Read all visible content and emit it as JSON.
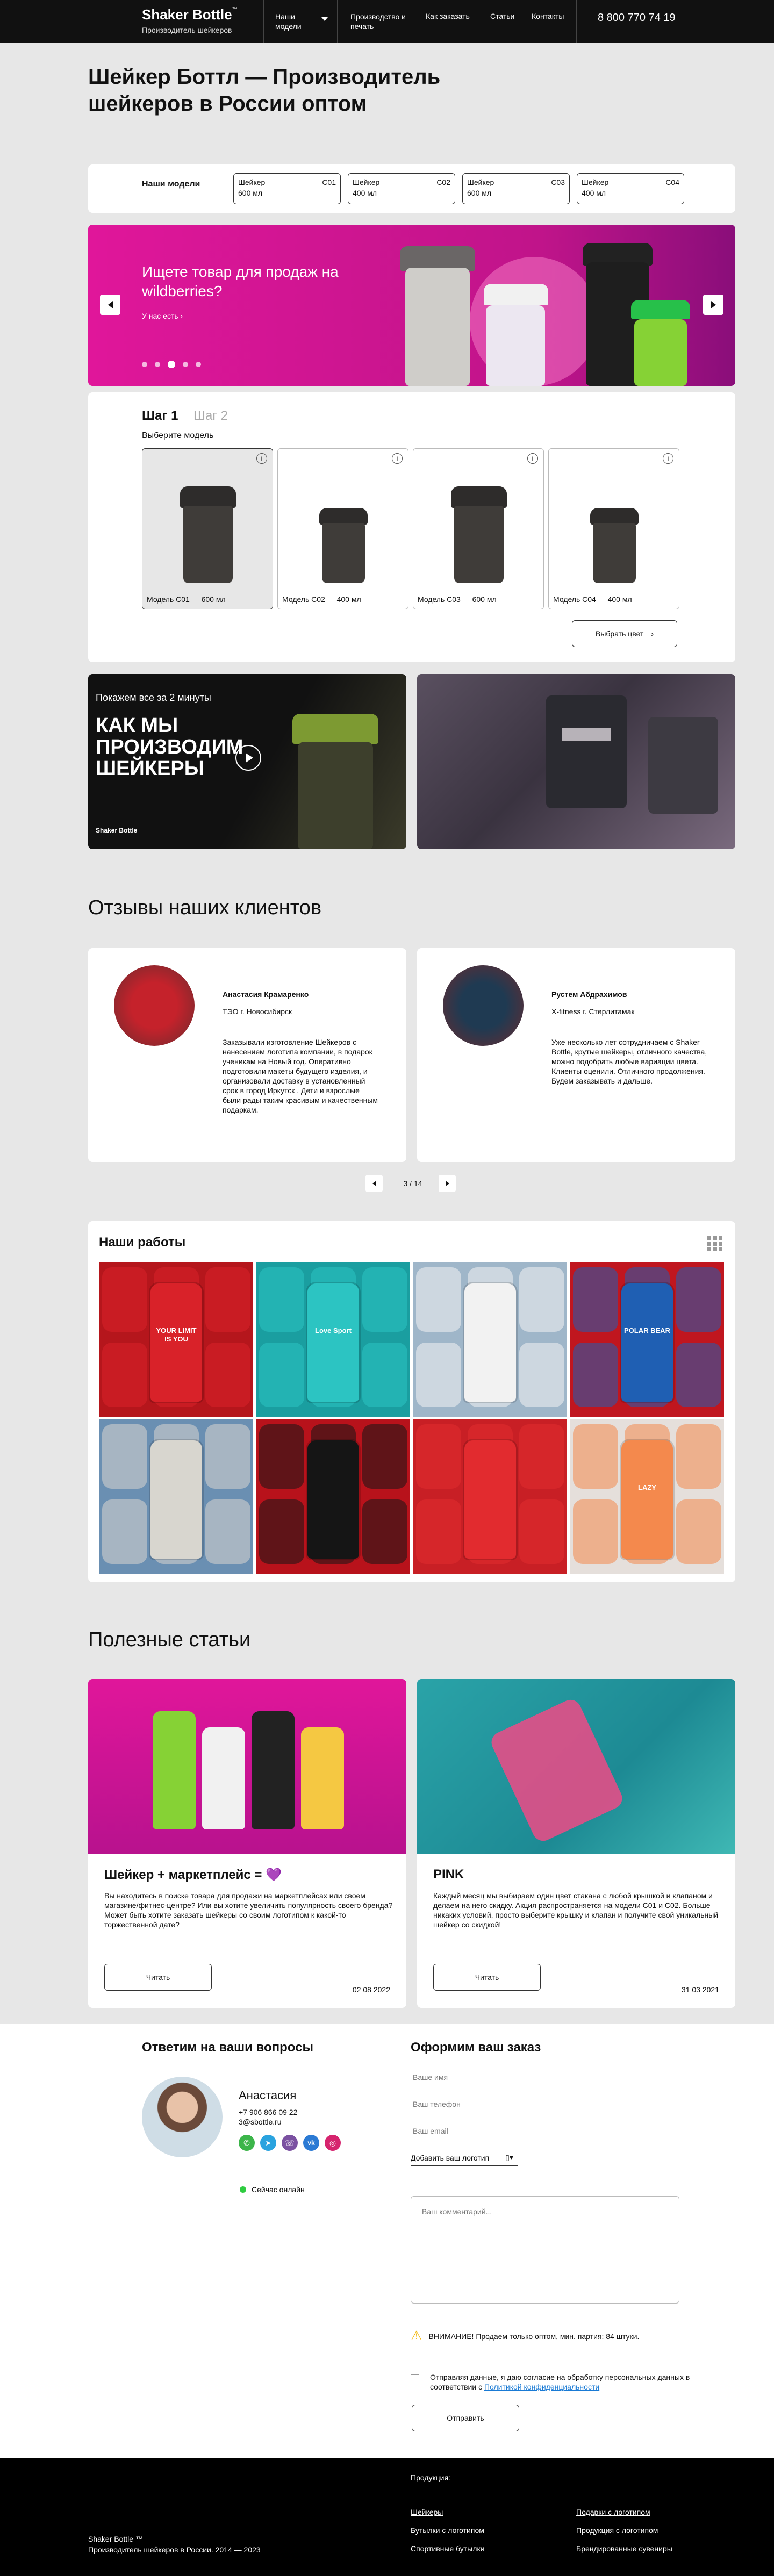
{
  "header": {
    "logo": "Shaker Bottle",
    "logo_tm": "™",
    "tagline": "Производитель шейкеров",
    "nav": [
      {
        "label": "Наши модели"
      },
      {
        "label": "Производство и печать"
      },
      {
        "label": "Как заказать"
      },
      {
        "label": "Статьи"
      },
      {
        "label": "Контакты"
      }
    ],
    "phone": "8 800 770 74 19"
  },
  "hero": {
    "title": "Шейкер Боттл — Производитель шейкеров в России оптом"
  },
  "models_bar": {
    "label": "Наши модели",
    "items": [
      {
        "name": "Шейкер",
        "code": "C01",
        "volume": "600 мл"
      },
      {
        "name": "Шейкер",
        "code": "C02",
        "volume": "400 мл"
      },
      {
        "name": "Шейкер",
        "code": "C03",
        "volume": "600 мл"
      },
      {
        "name": "Шейкер",
        "code": "C04",
        "volume": "400 мл"
      }
    ]
  },
  "banner": {
    "title": "Ищете товар для продаж на wildberries?",
    "link": "У нас есть",
    "dots": 5,
    "active_dot": 2,
    "accent": "#e0169a"
  },
  "configurator": {
    "step1": "Шаг 1",
    "step2": "Шаг 2",
    "subtitle": "Выберите модель",
    "models": [
      {
        "label": "Модель С01 — 600 мл",
        "selected": true
      },
      {
        "label": "Модель С02 — 400 мл",
        "selected": false
      },
      {
        "label": "Модель С03 — 600 мл",
        "selected": false
      },
      {
        "label": "Модель С04 — 400 мл",
        "selected": false
      }
    ],
    "next_button": "Выбрать цвет"
  },
  "video": {
    "kicker": "Покажем все за 2 минуты",
    "title": "КАК МЫ ПРОИЗВОДИМ ШЕЙКЕРЫ",
    "brand": "Shaker Bottle"
  },
  "reviews": {
    "title": "Отзывы наших клиентов",
    "items": [
      {
        "name": "Анастасия Крамаренко",
        "role": "ТЭО г. Новосибирск",
        "text": "Заказывали изготовление Шейкеров с нанесением логотипа компании, в подарок ученикам на Новый год. Оперативно подготовили макеты будущего изделия, и организовали доставку в установленный срок в город Иркутск . Дети и взрослые были рады таким красивым и качественным подаркам."
      },
      {
        "name": "Рустем Абдрахимов",
        "role": "X-fitness г. Стерлитамак",
        "text": "Уже несколько лет сотрудничаем с Shaker Bottle, крутые шейкеры, отличного качества, можно подобрать любые вариации цвета. Клиенты оценили. Отличного продолжения. Будем заказывать и дальше."
      }
    ],
    "pager": "3 / 14"
  },
  "works": {
    "title": "Наши работы",
    "tiles": [
      {
        "bg": "#b5161c",
        "fg": "#d92229",
        "text": "YOUR LIMIT IS YOU"
      },
      {
        "bg": "#1a9ea0",
        "fg": "#2cc4c2",
        "text": "Love Sport"
      },
      {
        "bg": "#9fb6c9",
        "fg": "#f2f2f2",
        "text": ""
      },
      {
        "bg": "#c0161f",
        "fg": "#1f5fb3",
        "text": "POLAR BEAR"
      },
      {
        "bg": "#6a8fb2",
        "fg": "#d8d6cf",
        "text": ""
      },
      {
        "bg": "#b8121b",
        "fg": "#151515",
        "text": ""
      },
      {
        "bg": "#c81f25",
        "fg": "#e22b2f",
        "text": ""
      },
      {
        "bg": "#e5dfdb",
        "fg": "#f4894d",
        "text": "LAZY"
      }
    ]
  },
  "articles": {
    "title": "Полезные статьи",
    "items": [
      {
        "title": "Шейкер + маркетплейс = 💜",
        "text": "Вы находитесь в поиске товара для продажи на маркетплейсах или своем магазине/фитнес-центре? Или вы хотите увеличить популярность своего бренда? Может быть хотите заказать шейкеры со своим логотипом к какой-то торжественной дате?",
        "button": "Читать",
        "date": "02 08 2022"
      },
      {
        "title": "PINK",
        "text": "Каждый месяц мы выбираем один цвет стакана с любой крышкой и клапаном и делаем на него скидку. Акция распространяется на модели С01 и С02. Больше никаких условий, просто выберите крышку и клапан и получите свой уникальный шейкер со скидкой!",
        "button": "Читать",
        "date": "31 03 2021"
      }
    ]
  },
  "contact": {
    "title": "Ответим на ваши вопросы",
    "name": "Анастасия",
    "phone": "+7 906 866 09 22",
    "email": "3@sbottle.ru",
    "status": "Сейчас онлайн"
  },
  "order": {
    "title": "Оформим ваш заказ",
    "fields": [
      {
        "placeholder": "Ваше имя"
      },
      {
        "placeholder": "Ваш телефон"
      },
      {
        "placeholder": "Ваш email"
      }
    ],
    "upload": "Добавить ваш логотип",
    "comment_placeholder": "Ваш комментарий...",
    "warning": "ВНИМАНИЕ! Продаем только оптом, мин. партия: 84 штуки.",
    "consent": "Отправляя данные, я даю согласие на обработку персональных данных в соответствии с",
    "consent_link": "Политикой конфиденциальности",
    "submit": "Отправить"
  },
  "footer": {
    "brand": "Shaker Bottle ™",
    "tagline": "Производитель шейкеров в России. 2014 — 2023",
    "products_title": "Продукция:",
    "col1": [
      "Шейкеры",
      "Бутылки с логотипом",
      "Спортивные бутылки"
    ],
    "col2": [
      "Подарки с логотипом",
      "Продукция с логотипом",
      "Брендированные сувениры"
    ]
  },
  "colors": {
    "magenta": "#e0169a",
    "dark": "#111111",
    "green": "#2ecc40"
  }
}
